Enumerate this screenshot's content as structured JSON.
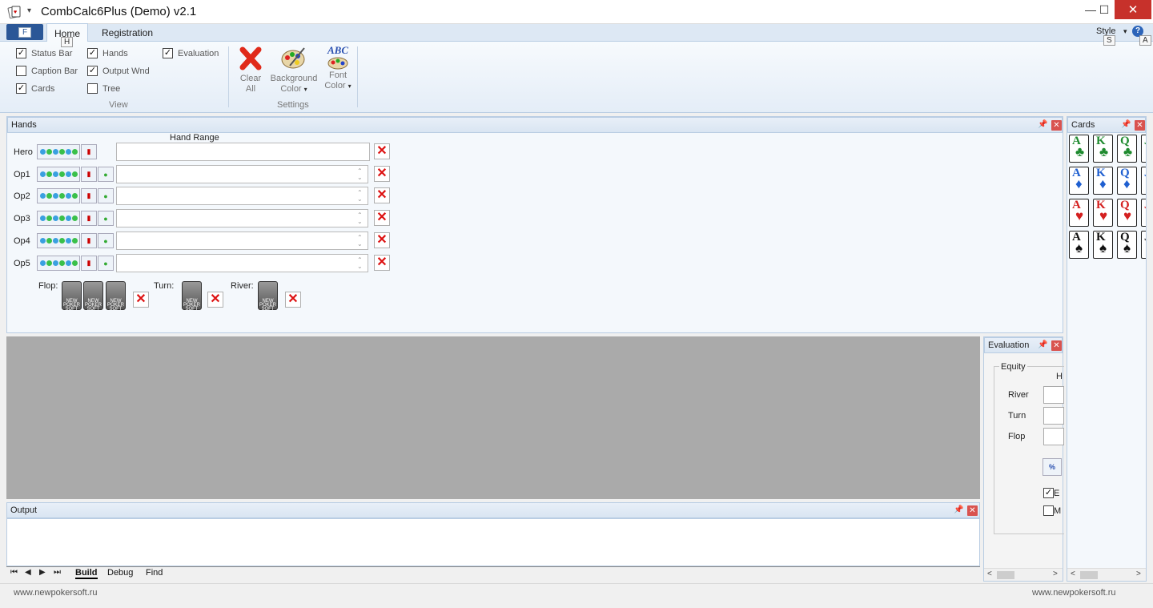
{
  "window": {
    "title": "CombCalc6Plus (Demo)  v2.1",
    "min": "—",
    "max": "☐",
    "close": "✕"
  },
  "ribbon": {
    "file_label": "F",
    "tabs": [
      {
        "label": "Home",
        "keytip": "H"
      },
      {
        "label": "Registration"
      }
    ],
    "style_label": "Style",
    "style_keytip": "S",
    "help_keytip": "A",
    "view_group": {
      "label": "View",
      "checks": [
        {
          "label": "Status Bar",
          "checked": true
        },
        {
          "label": "Caption Bar",
          "checked": false
        },
        {
          "label": "Cards",
          "checked": true
        },
        {
          "label": "Hands",
          "checked": true
        },
        {
          "label": "Output Wnd",
          "checked": true
        },
        {
          "label": "Tree",
          "checked": false
        },
        {
          "label": "Evaluation",
          "checked": true
        }
      ]
    },
    "settings_group": {
      "label": "Settings",
      "clear": {
        "line1": "Clear",
        "line2": "All"
      },
      "bg": {
        "line1": "Background",
        "line2": "Color"
      },
      "font": {
        "line1": "Font",
        "line2": "Color",
        "icon_text": "ABC"
      }
    }
  },
  "hands": {
    "title": "Hands",
    "range_header": "Hand Range",
    "rows": [
      "Hero",
      "Op1",
      "Op2",
      "Op3",
      "Op4",
      "Op5"
    ],
    "flop_label": "Flop:",
    "turn_label": "Turn:",
    "river_label": "River:",
    "card_back_text": "NEW POKER SOFT"
  },
  "output": {
    "title": "Output",
    "tabs": [
      "Build",
      "Debug",
      "Find"
    ]
  },
  "evaluation": {
    "title": "Evaluation",
    "group_label": "Equity",
    "col_header": "H",
    "rows": [
      "River",
      "Turn",
      "Flop"
    ],
    "check1": {
      "label": "E",
      "checked": true
    },
    "check2": {
      "label": "M",
      "checked": false
    }
  },
  "cards": {
    "title": "Cards",
    "suits": [
      {
        "name": "clubs",
        "symbol": "♣",
        "color": "#1e8a2e",
        "ranks": [
          "A",
          "K",
          "Q",
          "J"
        ]
      },
      {
        "name": "diamonds",
        "symbol": "♦",
        "color": "#1f5fd0",
        "ranks": [
          "A",
          "K",
          "Q",
          "J"
        ]
      },
      {
        "name": "hearts",
        "symbol": "♥",
        "color": "#d42020",
        "ranks": [
          "A",
          "K",
          "Q",
          "J"
        ]
      },
      {
        "name": "spades",
        "symbol": "♠",
        "color": "#111111",
        "ranks": [
          "A",
          "K",
          "Q",
          "J"
        ]
      }
    ]
  },
  "status": {
    "left": "www.newpokersoft.ru",
    "right": "www.newpokersoft.ru"
  },
  "colors": {
    "accent": "#2b5797",
    "panel_border": "#b9cde3",
    "close_red": "#c7312b"
  }
}
